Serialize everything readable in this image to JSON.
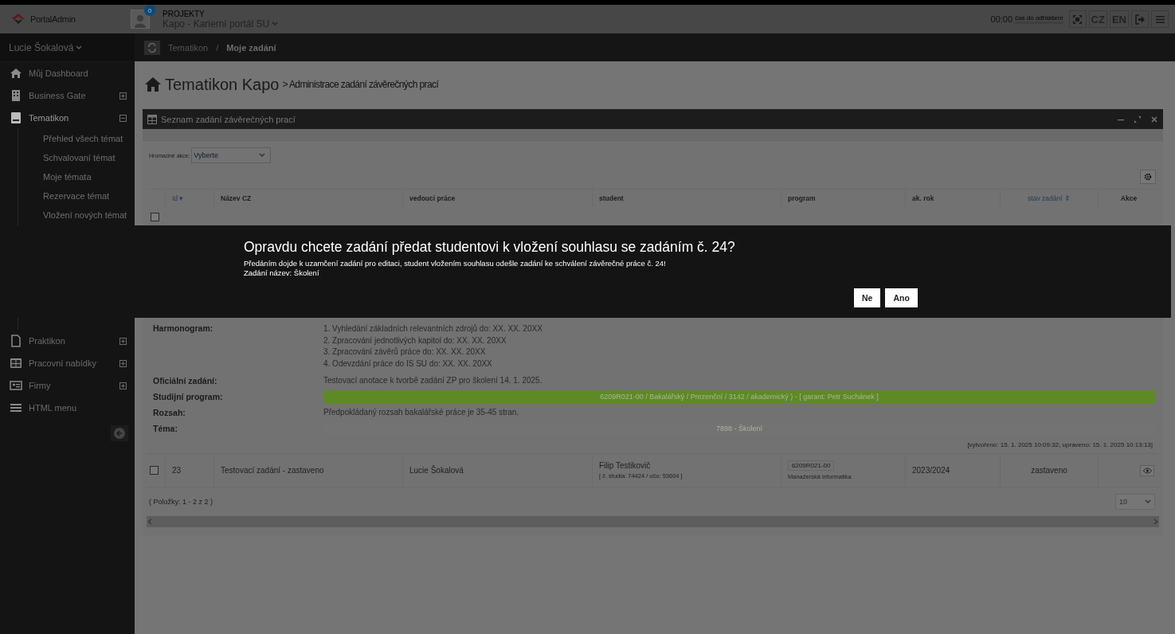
{
  "header": {
    "logo": "PortalAdmin",
    "notifications": "0",
    "project_label": "PROJEKTY",
    "project": "Kapo - Karierní portál SU",
    "timer": "00:00",
    "timer_label": "čas do odhlášení",
    "languages": [
      "CZ",
      "EN"
    ]
  },
  "user": "Lucie Šokalová",
  "breadcrumb": [
    "Tematikon",
    "/",
    "Moje zadání"
  ],
  "sidebar": {
    "items": [
      {
        "label": "Můj Dashboard"
      },
      {
        "label": "Business Gate",
        "expanded": false
      },
      {
        "label": "Tematikon",
        "expanded": true,
        "children": [
          {
            "label": "Přehled všech témat"
          },
          {
            "label": "Schvalovaní témat"
          },
          {
            "label": "Moje témata"
          },
          {
            "label": "Rezervace témat"
          },
          {
            "label": "Vložení nových témat"
          }
        ]
      },
      {
        "label": "Praktikon",
        "expanded": false
      },
      {
        "label": "Pracovní nabídky",
        "expanded": false
      },
      {
        "label": "Firmy",
        "expanded": false
      },
      {
        "label": "HTML menu"
      }
    ]
  },
  "page": {
    "title": "Tematikon Kapo",
    "subtitle": "> Administrace zadání závěrečných prací"
  },
  "panel": {
    "title": "Seznam zadání závěrečných prací",
    "bulk_label": "Hromadné akce:",
    "bulk_value": "Vyberte",
    "columns": [
      {
        "label": "Id",
        "kind": "sortable",
        "sort_icon": "▾"
      },
      {
        "label": "Název CZ",
        "kind": "plain"
      },
      {
        "label": "vedoucí práce",
        "kind": "plain"
      },
      {
        "label": "student",
        "kind": "plain"
      },
      {
        "label": "program",
        "kind": "plain"
      },
      {
        "label": "ak. rok",
        "kind": "plain"
      },
      {
        "label": "stav zadání",
        "kind": "sortable",
        "sort_icon": "⇕"
      },
      {
        "label": "Akce",
        "kind": "plain"
      }
    ],
    "header_checked": false,
    "detail": [
      {
        "label": "Harmonogram:",
        "kind": "lines",
        "lines": [
          "1. Vyhledání základních relevantních zdrojů do: XX. XX. 20XX",
          "2. Zpracování jednotlivých kapitol do: XX. XX. 20XX",
          "3. Zpracování závěrů práce do: XX. XX. 20XX",
          "4. Odevzdání práce do IS SU do: XX. XX. 20XX"
        ]
      },
      {
        "label": "Oficiální zadání:",
        "kind": "text",
        "value": "Testovací anotace k tvorbě zadání ZP pro školení 14. 1. 2025."
      },
      {
        "label": "Studijní program:",
        "kind": "bar",
        "value": "6209R021-00 / Bakalářský / Prezenční / 3142 / akademický ) - [ garant: Petr Suchánek ]",
        "color": "#5e8a25"
      },
      {
        "label": "Rozsah:",
        "kind": "text",
        "value": "Předpokládaný rozsah bakalářské práce je 35-45 stran."
      },
      {
        "label": "Téma:",
        "kind": "bar",
        "value": "7898 - Školení",
        "color": "#737373"
      }
    ],
    "meta": "[vytvořeno: 15. 1. 2025 10:09:32, upraveno: 15. 1. 2025 10:13:13]",
    "rows": [
      {
        "checked": false,
        "id": "23",
        "name": "Testovací zadání - zastaveno",
        "supervisor": "Lucie Šokalová",
        "student": "Filip Testikovič",
        "student_meta": "[ č. studia: 74424 / učo: 53604 ]",
        "program_code": "6209R021-00",
        "program": "Manažerská informatika",
        "year": "2023/2024",
        "status": "zastaveno"
      }
    ],
    "footer": "( Položky: 1 - 2 z 2 )",
    "page_size": "10"
  },
  "modal": {
    "title": "Opravdu chcete zadání předat studentovi k vložení souhlasu se zadáním č. 24?",
    "lines": [
      "Předáním dojde k uzamčení zadání pro editaci, student vložením souhlasu odešle zadání ke schválení závěrečné práce č. 24!",
      "Zadání název: Školení"
    ],
    "buttons": [
      "Ne",
      "Ano"
    ]
  }
}
